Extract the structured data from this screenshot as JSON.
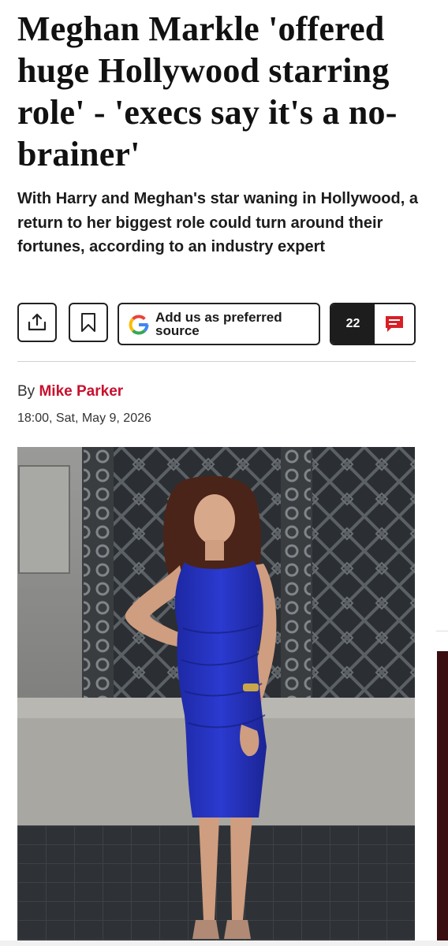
{
  "article": {
    "headline": "Meghan Markle 'offered huge Hollywood starring role' - 'execs say it's a no-brainer'",
    "standfirst": "With Harry and Meghan's star waning in Hollywood, a return to her biggest role could turn around their fortunes, according to an industry expert",
    "byline_prefix": "By",
    "author": "Mike Parker",
    "date": "18:00, Sat, May 9, 2026"
  },
  "actions": {
    "share_icon": "share-icon",
    "bookmark_icon": "bookmark-icon",
    "google_label": "Add us as preferred source",
    "comment_count": "22",
    "comment_icon": "comment-icon"
  },
  "colors": {
    "author": "#c8102e",
    "comment_icon": "#d91f26",
    "dress": "#2733b8",
    "count_bg": "#1d1d1d"
  },
  "photo": {
    "subject": "Woman in blue sleeveless dress posing in front of ornate window grille"
  }
}
